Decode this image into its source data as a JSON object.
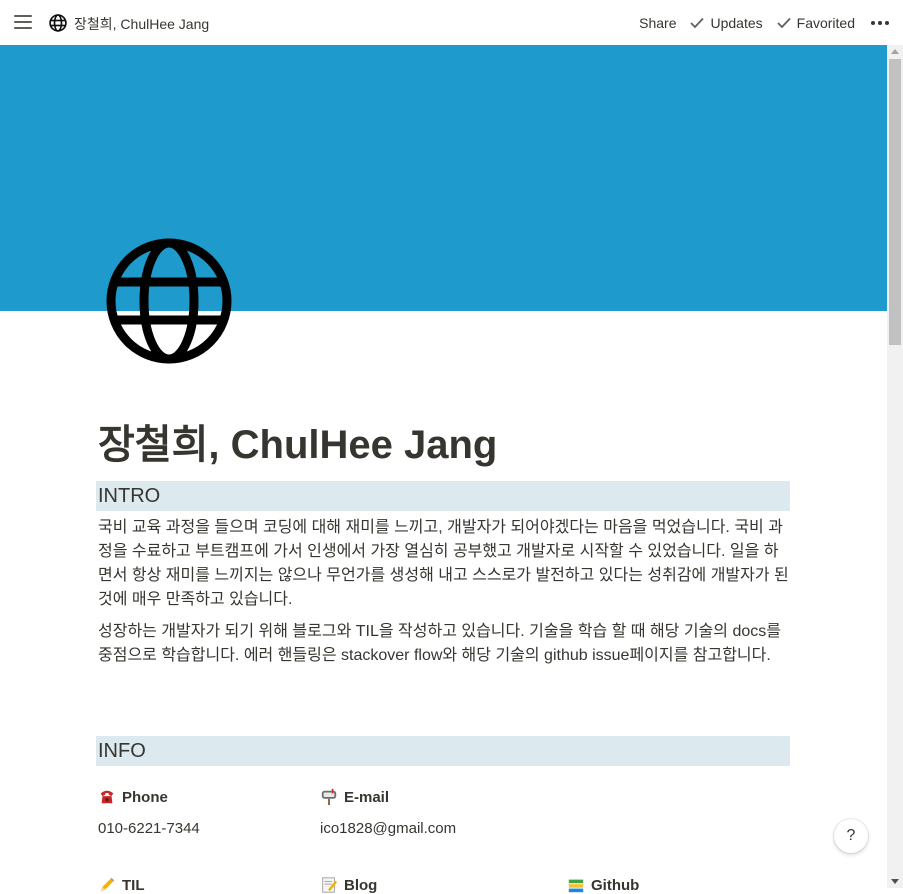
{
  "topbar": {
    "menu_icon": "hamburger-icon",
    "page_icon": "globe-icon",
    "breadcrumb_title": "장철희, ChulHee Jang",
    "share_label": "Share",
    "updates_label": "Updates",
    "favorited_label": "Favorited",
    "more_icon": "more-dots-icon"
  },
  "cover": {
    "color": "#1e9bcc"
  },
  "page": {
    "icon": "globe-icon",
    "title": "장철희, ChulHee Jang"
  },
  "intro": {
    "heading": "INTRO",
    "paragraph1": " 국비 교육 과정을 들으며 코딩에 대해 재미를 느끼고, 개발자가 되어야겠다는 마음을 먹었습니다. 국비 과정을 수료하고 부트캠프에 가서 인생에서 가장 열심히 공부했고 개발자로 시작할 수 있었습니다. 일을 하면서 항상 재미를 느끼지는 않으나 무언가를 생성해 내고 스스로가 발전하고 있다는 성취감에 개발자가 된 것에 매우 만족하고 있습니다.",
    "paragraph2": " 성장하는 개발자가 되기 위해 블로그와 TIL을 작성하고 있습니다. 기술을 학습 할 때 해당 기술의 docs를 중점으로 학습합니다. 에러 핸들링은 stackover flow와 해당 기술의 github issue페이지를 참고합니다."
  },
  "info": {
    "heading": "INFO",
    "phone_label": "Phone",
    "phone_icon": "telephone-icon",
    "phone_value": "010-6221-7344",
    "email_label": "E-mail",
    "email_icon": "mailbox-icon",
    "email_value": "ico1828@gmail.com",
    "til_label": "TIL",
    "til_icon": "pencil-icon",
    "blog_label": "Blog",
    "blog_icon": "memo-icon",
    "github_label": "Github",
    "github_icon": "books-icon"
  },
  "help": {
    "label": "?"
  },
  "colors": {
    "cover": "#1e9bcc",
    "section_heading_bg": "#dce9ee",
    "text": "#37352f"
  }
}
